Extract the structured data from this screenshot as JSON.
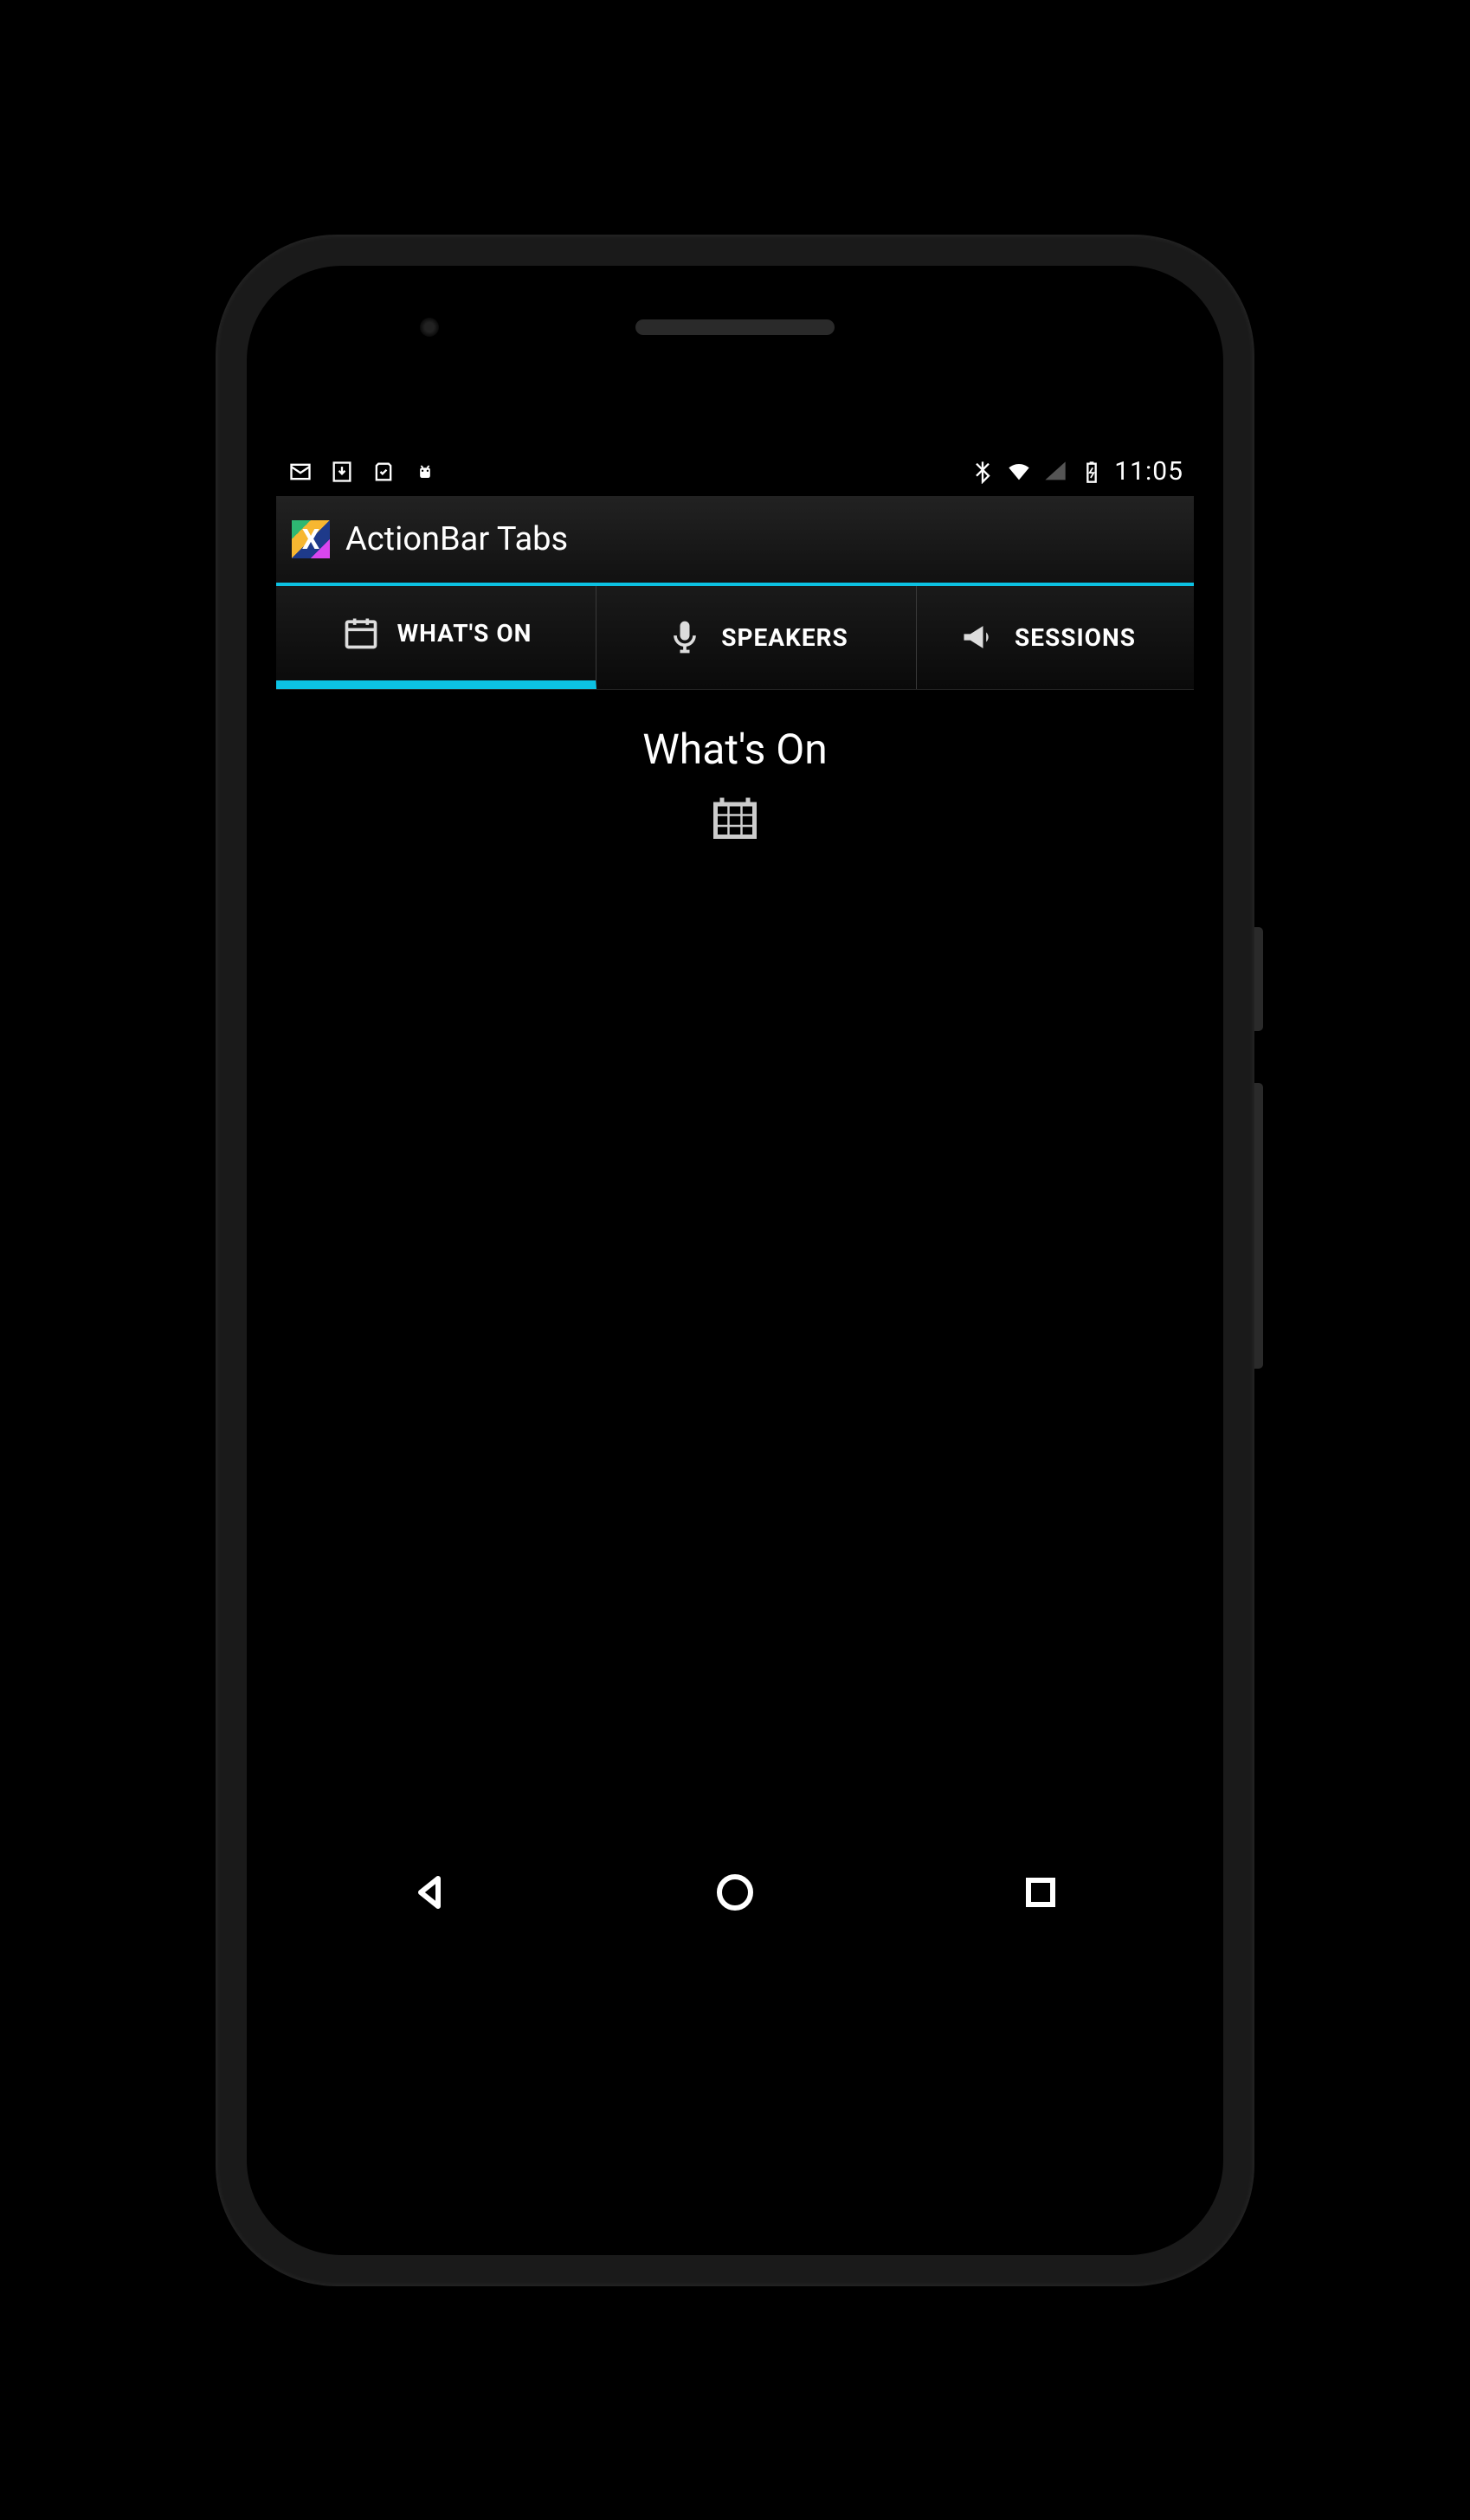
{
  "statusbar": {
    "time": "11:05"
  },
  "actionbar": {
    "title": "ActionBar Tabs"
  },
  "tabs": [
    {
      "label": "WHAT'S ON",
      "icon": "calendar-icon",
      "active": true
    },
    {
      "label": "SPEAKERS",
      "icon": "mic-icon",
      "active": false
    },
    {
      "label": "SESSIONS",
      "icon": "megaphone-icon",
      "active": false
    }
  ],
  "content": {
    "title": "What's On",
    "icon": "calendar-icon"
  }
}
